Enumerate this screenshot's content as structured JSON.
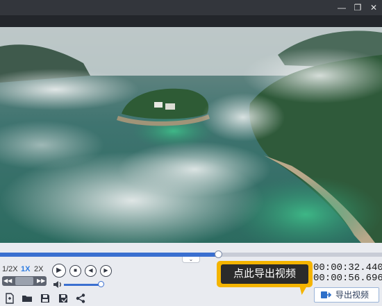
{
  "window": {
    "minimize_glyph": "—",
    "maximize_glyph": "❐",
    "close_glyph": "✕"
  },
  "player": {
    "playback_progress": 0.571,
    "volume_level": 0.95,
    "speeds": [
      "1/2X",
      "1X",
      "2X"
    ],
    "active_speed": "1X",
    "current_time": "00:00:32.440",
    "total_time": "00:00:56.696"
  },
  "callout": {
    "text": "点此导出视频"
  },
  "export_button": {
    "label": "导出视频"
  },
  "colors": {
    "accent_blue": "#3a6fd0",
    "callout_yellow": "#f4b400",
    "speed_active": "#2d7be0"
  },
  "icons": {
    "transport": [
      "play-icon",
      "stop-icon",
      "prev-frame-icon",
      "next-frame-icon"
    ],
    "toolbar": [
      "new-file-icon",
      "open-folder-icon",
      "save-icon",
      "save-as-icon",
      "share-icon"
    ],
    "export": "export-video-icon"
  }
}
